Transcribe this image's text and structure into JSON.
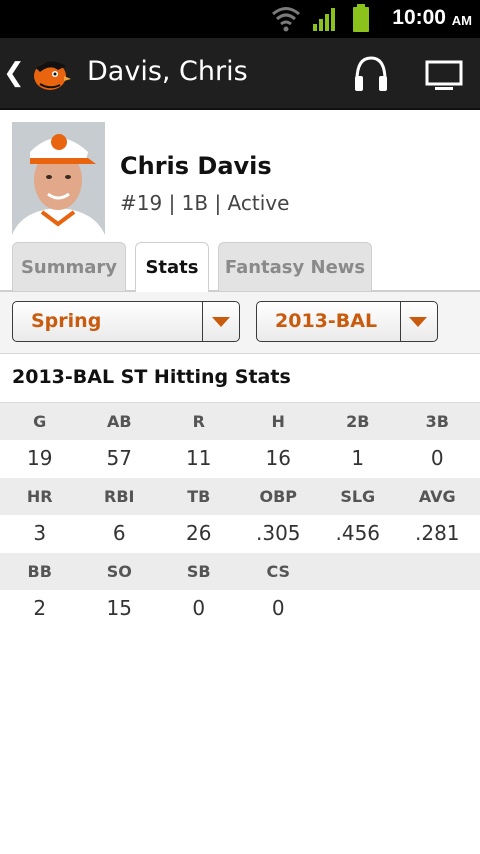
{
  "status_bar": {
    "time": "10:00",
    "ampm": "AM",
    "icons": [
      "wifi-icon",
      "signal-icon",
      "battery-icon"
    ]
  },
  "action_bar": {
    "title": "Davis, Chris",
    "icons": [
      "back-chevron-icon",
      "orioles-logo-icon",
      "headphones-icon",
      "tv-icon"
    ]
  },
  "player": {
    "name": "Chris Davis",
    "meta": "#19 | 1B | Active"
  },
  "tabs": [
    {
      "label": "Summary",
      "active": false
    },
    {
      "label": "Stats",
      "active": true
    },
    {
      "label": "Fantasy News",
      "active": false
    }
  ],
  "filters": {
    "season_type": "Spring",
    "season_team": "2013-BAL"
  },
  "stats": {
    "title": "2013-BAL ST Hitting Stats",
    "rows": [
      {
        "headers": [
          "G",
          "AB",
          "R",
          "H",
          "2B",
          "3B"
        ],
        "values": [
          "19",
          "57",
          "11",
          "16",
          "1",
          "0"
        ]
      },
      {
        "headers": [
          "HR",
          "RBI",
          "TB",
          "OBP",
          "SLG",
          "AVG"
        ],
        "values": [
          "3",
          "6",
          "26",
          ".305",
          ".456",
          ".281"
        ]
      },
      {
        "headers": [
          "BB",
          "SO",
          "SB",
          "CS",
          "",
          ""
        ],
        "values": [
          "2",
          "15",
          "0",
          "0",
          "",
          ""
        ]
      }
    ]
  },
  "colors": {
    "accent": "#c85b0e",
    "action_bar": "#1f1f1f",
    "status_bar": "#000000",
    "battery": "#8bc21c"
  }
}
